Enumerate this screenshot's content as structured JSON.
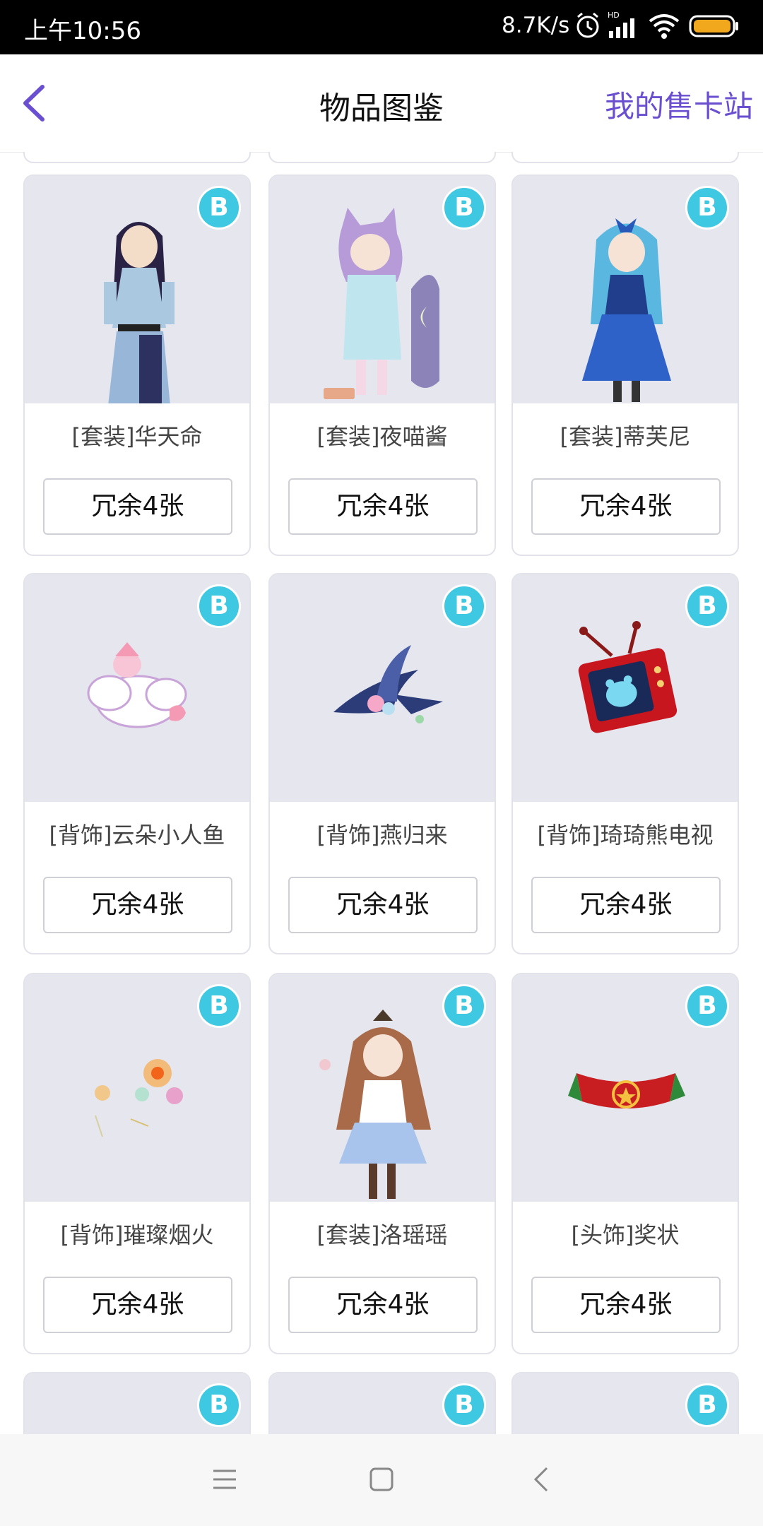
{
  "status_bar": {
    "time": "上午10:56",
    "network_speed": "8.7K/s",
    "hd": "HD"
  },
  "header": {
    "title": "物品图鉴",
    "right_link": "我的售卡站"
  },
  "badge_label": "B",
  "items": [
    {
      "name": "[套装]华天命",
      "qty": "冗余4张"
    },
    {
      "name": "[套装]夜喵酱",
      "qty": "冗余4张"
    },
    {
      "name": "[套装]蒂芙尼",
      "qty": "冗余4张"
    },
    {
      "name": "[背饰]云朵小人鱼",
      "qty": "冗余4张"
    },
    {
      "name": "[背饰]燕归来",
      "qty": "冗余4张"
    },
    {
      "name": "[背饰]琦琦熊电视",
      "qty": "冗余4张"
    },
    {
      "name": "[背饰]璀璨烟火",
      "qty": "冗余4张"
    },
    {
      "name": "[套装]洛瑶瑶",
      "qty": "冗余4张"
    },
    {
      "name": "[头饰]奖状",
      "qty": "冗余4张"
    }
  ],
  "colors": {
    "accent": "#6a4fd0",
    "badge": "#3ec8e2",
    "image_bg": "#e6e6ee"
  }
}
